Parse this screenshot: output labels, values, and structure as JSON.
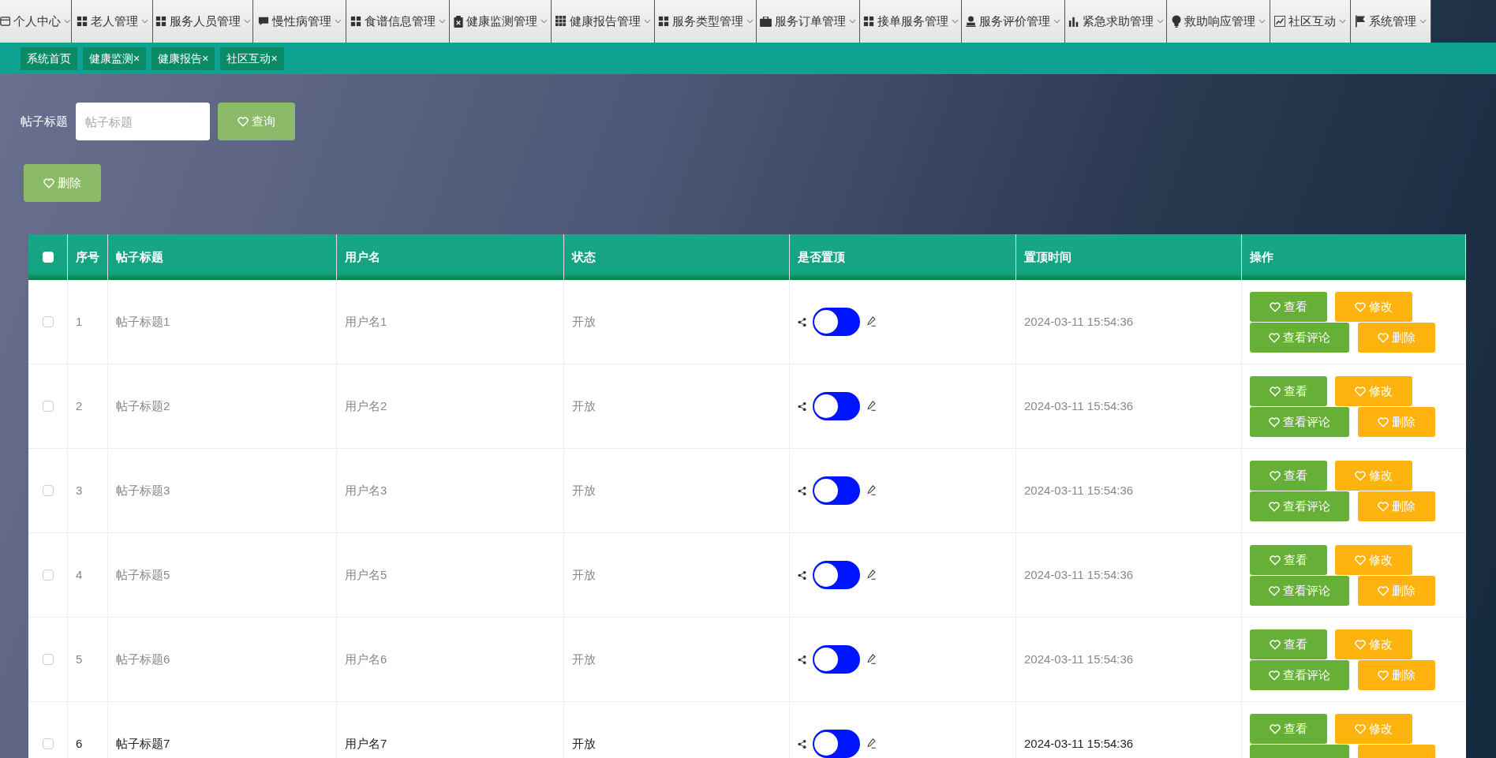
{
  "menu": [
    {
      "label": "个人中心"
    },
    {
      "label": "老人管理"
    },
    {
      "label": "服务人员管理"
    },
    {
      "label": "慢性病管理"
    },
    {
      "label": "食谱信息管理"
    },
    {
      "label": "健康监测管理"
    },
    {
      "label": "健康报告管理"
    },
    {
      "label": "服务类型管理"
    },
    {
      "label": "服务订单管理"
    },
    {
      "label": "接单服务管理"
    },
    {
      "label": "服务评价管理"
    },
    {
      "label": "紧急求助管理"
    },
    {
      "label": "救助响应管理"
    },
    {
      "label": "社区互动"
    },
    {
      "label": "系统管理"
    }
  ],
  "tabs": [
    {
      "label": "系统首页"
    },
    {
      "label": "健康监测",
      "close": "×"
    },
    {
      "label": "健康报告",
      "close": "×"
    },
    {
      "label": "社区互动",
      "close": "×"
    }
  ],
  "search": {
    "label": "帖子标题",
    "placeholder": "帖子标题",
    "button": "查询"
  },
  "delete_button": "删除",
  "table": {
    "all_checked": false,
    "columns": [
      "序号",
      "帖子标题",
      "用户名",
      "状态",
      "是否置顶",
      "置顶时间",
      "操作"
    ],
    "rows": [
      {
        "index": "1",
        "title": "帖子标题1",
        "user": "用户名1",
        "status": "开放",
        "pinned": false,
        "time": "2024-03-11 15:54:36",
        "highlighted": false,
        "checked": false,
        "actions": [
          {
            "label": "查看",
            "kind": "green"
          },
          {
            "label": "修改",
            "kind": "orange"
          },
          {
            "label": "查看评论",
            "kind": "green"
          },
          {
            "label": "删除",
            "kind": "orange"
          }
        ]
      },
      {
        "index": "2",
        "title": "帖子标题2",
        "user": "用户名2",
        "status": "开放",
        "pinned": false,
        "time": "2024-03-11 15:54:36",
        "highlighted": false,
        "checked": false,
        "actions": [
          {
            "label": "查看",
            "kind": "green"
          },
          {
            "label": "修改",
            "kind": "orange"
          },
          {
            "label": "查看评论",
            "kind": "green"
          },
          {
            "label": "删除",
            "kind": "orange"
          }
        ]
      },
      {
        "index": "3",
        "title": "帖子标题3",
        "user": "用户名3",
        "status": "开放",
        "pinned": false,
        "time": "2024-03-11 15:54:36",
        "highlighted": false,
        "checked": false,
        "actions": [
          {
            "label": "查看",
            "kind": "green"
          },
          {
            "label": "修改",
            "kind": "orange"
          },
          {
            "label": "查看评论",
            "kind": "green"
          },
          {
            "label": "删除",
            "kind": "orange"
          }
        ]
      },
      {
        "index": "4",
        "title": "帖子标题5",
        "user": "用户名5",
        "status": "开放",
        "pinned": false,
        "time": "2024-03-11 15:54:36",
        "highlighted": false,
        "checked": false,
        "actions": [
          {
            "label": "查看",
            "kind": "green"
          },
          {
            "label": "修改",
            "kind": "orange"
          },
          {
            "label": "查看评论",
            "kind": "green"
          },
          {
            "label": "删除",
            "kind": "orange"
          }
        ]
      },
      {
        "index": "5",
        "title": "帖子标题6",
        "user": "用户名6",
        "status": "开放",
        "pinned": false,
        "time": "2024-03-11 15:54:36",
        "highlighted": false,
        "checked": false,
        "actions": [
          {
            "label": "查看",
            "kind": "green"
          },
          {
            "label": "修改",
            "kind": "orange"
          },
          {
            "label": "查看评论",
            "kind": "green"
          },
          {
            "label": "删除",
            "kind": "orange"
          }
        ]
      },
      {
        "index": "6",
        "title": "帖子标题7",
        "user": "用户名7",
        "status": "开放",
        "pinned": false,
        "time": "2024-03-11 15:54:36",
        "highlighted": true,
        "checked": false,
        "actions": [
          {
            "label": "查看",
            "kind": "green"
          },
          {
            "label": "修改",
            "kind": "orange"
          },
          {
            "kind": "green"
          },
          {
            "kind": "orange"
          }
        ]
      }
    ]
  }
}
